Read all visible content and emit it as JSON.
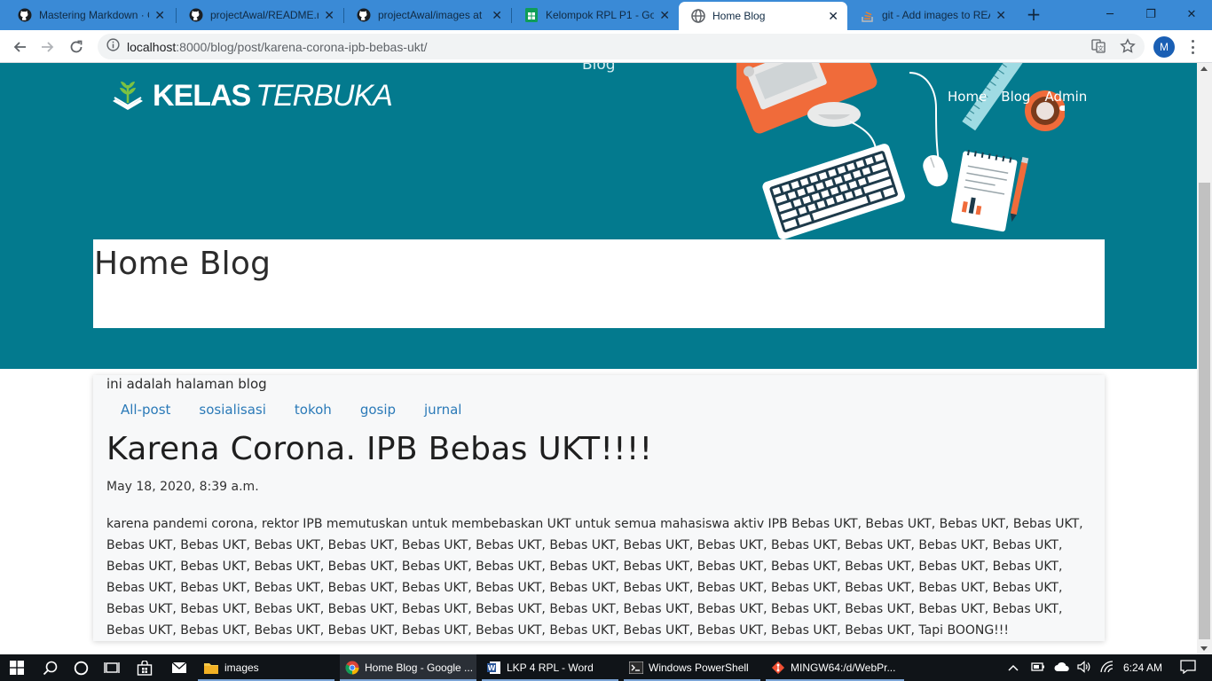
{
  "browser": {
    "tabs": [
      {
        "title": "Mastering Markdown · G",
        "icon": "github-icon"
      },
      {
        "title": "projectAwal/README.m",
        "icon": "github-icon"
      },
      {
        "title": "projectAwal/images at",
        "icon": "github-icon"
      },
      {
        "title": "Kelompok RPL P1 - Goo",
        "icon": "sheets-icon"
      },
      {
        "title": "Home Blog",
        "icon": "globe-icon",
        "active": true
      },
      {
        "title": "git - Add images to REA",
        "icon": "stackoverflow-icon"
      }
    ],
    "url_host": "localhost",
    "url_rest": ":8000/blog/post/karena-corona-ipb-bebas-ukt/",
    "profile_initial": "M"
  },
  "site": {
    "logo_bold": "KELAS",
    "logo_light": "TERBUKA",
    "hero_label": "Blog",
    "nav": [
      "Home",
      "Blog",
      "Admin"
    ],
    "page_title": "Home Blog",
    "accent": "#037a8e"
  },
  "content": {
    "intro": "ini adalah halaman blog",
    "categories": [
      "All-post",
      "sosialisasi",
      "tokoh",
      "gosip",
      "jurnal"
    ],
    "post_title": "Karena Corona. IPB Bebas UKT!!!!",
    "post_date": "May 18, 2020, 8:39 a.m.",
    "post_body": "karena pandemi corona, rektor IPB memutuskan untuk membebaskan UKT untuk semua mahasiswa aktiv IPB Bebas UKT, Bebas UKT, Bebas UKT, Bebas UKT, Bebas UKT, Bebas UKT, Bebas UKT, Bebas UKT, Bebas UKT, Bebas UKT, Bebas UKT, Bebas UKT, Bebas UKT, Bebas UKT, Bebas UKT, Bebas UKT, Bebas UKT, Bebas UKT, Bebas UKT, Bebas UKT, Bebas UKT, Bebas UKT, Bebas UKT, Bebas UKT, Bebas UKT, Bebas UKT, Bebas UKT, Bebas UKT, Bebas UKT, Bebas UKT, Bebas UKT, Bebas UKT, Bebas UKT, Bebas UKT, Bebas UKT, Bebas UKT, Bebas UKT, Bebas UKT, Bebas UKT, Bebas UKT, Bebas UKT, Bebas UKT, Bebas UKT, Bebas UKT, Bebas UKT, Bebas UKT, Bebas UKT, Bebas UKT, Bebas UKT, Bebas UKT, Bebas UKT, Bebas UKT, Bebas UKT, Bebas UKT, Bebas UKT, Bebas UKT, Bebas UKT, Bebas UKT, Bebas UKT, Bebas UKT, Bebas UKT, Bebas UKT, Bebas UKT, Bebas UKT, Bebas UKT, Bebas UKT, Bebas UKT, Tapi BOONG!!!"
  },
  "taskbar": {
    "apps": [
      {
        "label": "images",
        "icon": "folder-icon"
      },
      {
        "label": "Home Blog - Google ...",
        "icon": "chrome-icon"
      },
      {
        "label": "LKP 4 RPL - Word",
        "icon": "word-icon"
      },
      {
        "label": "Windows PowerShell",
        "icon": "powershell-icon"
      },
      {
        "label": "MINGW64:/d/WebPr...",
        "icon": "git-icon"
      }
    ],
    "clock": "6:24 AM"
  }
}
